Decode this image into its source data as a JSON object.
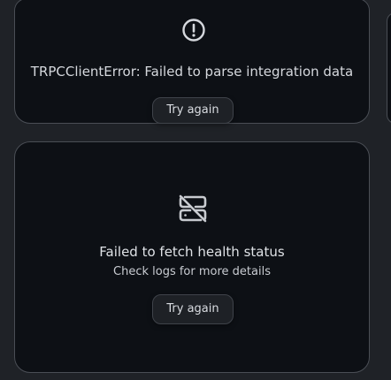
{
  "integration_card": {
    "icon": "alert-circle-icon",
    "error_message": "TRPCClientError: Failed to parse integration data",
    "retry_label": "Try again"
  },
  "health_card": {
    "icon": "server-off-icon",
    "title": "Failed to fetch health status",
    "subtitle": "Check logs for more details",
    "retry_label": "Try again"
  },
  "colors": {
    "page_background": "#1f2227",
    "card_background": "#0d1015",
    "card_border": "#4a4e55",
    "text": "#d5d8dd",
    "button_background": "#1e2126"
  }
}
